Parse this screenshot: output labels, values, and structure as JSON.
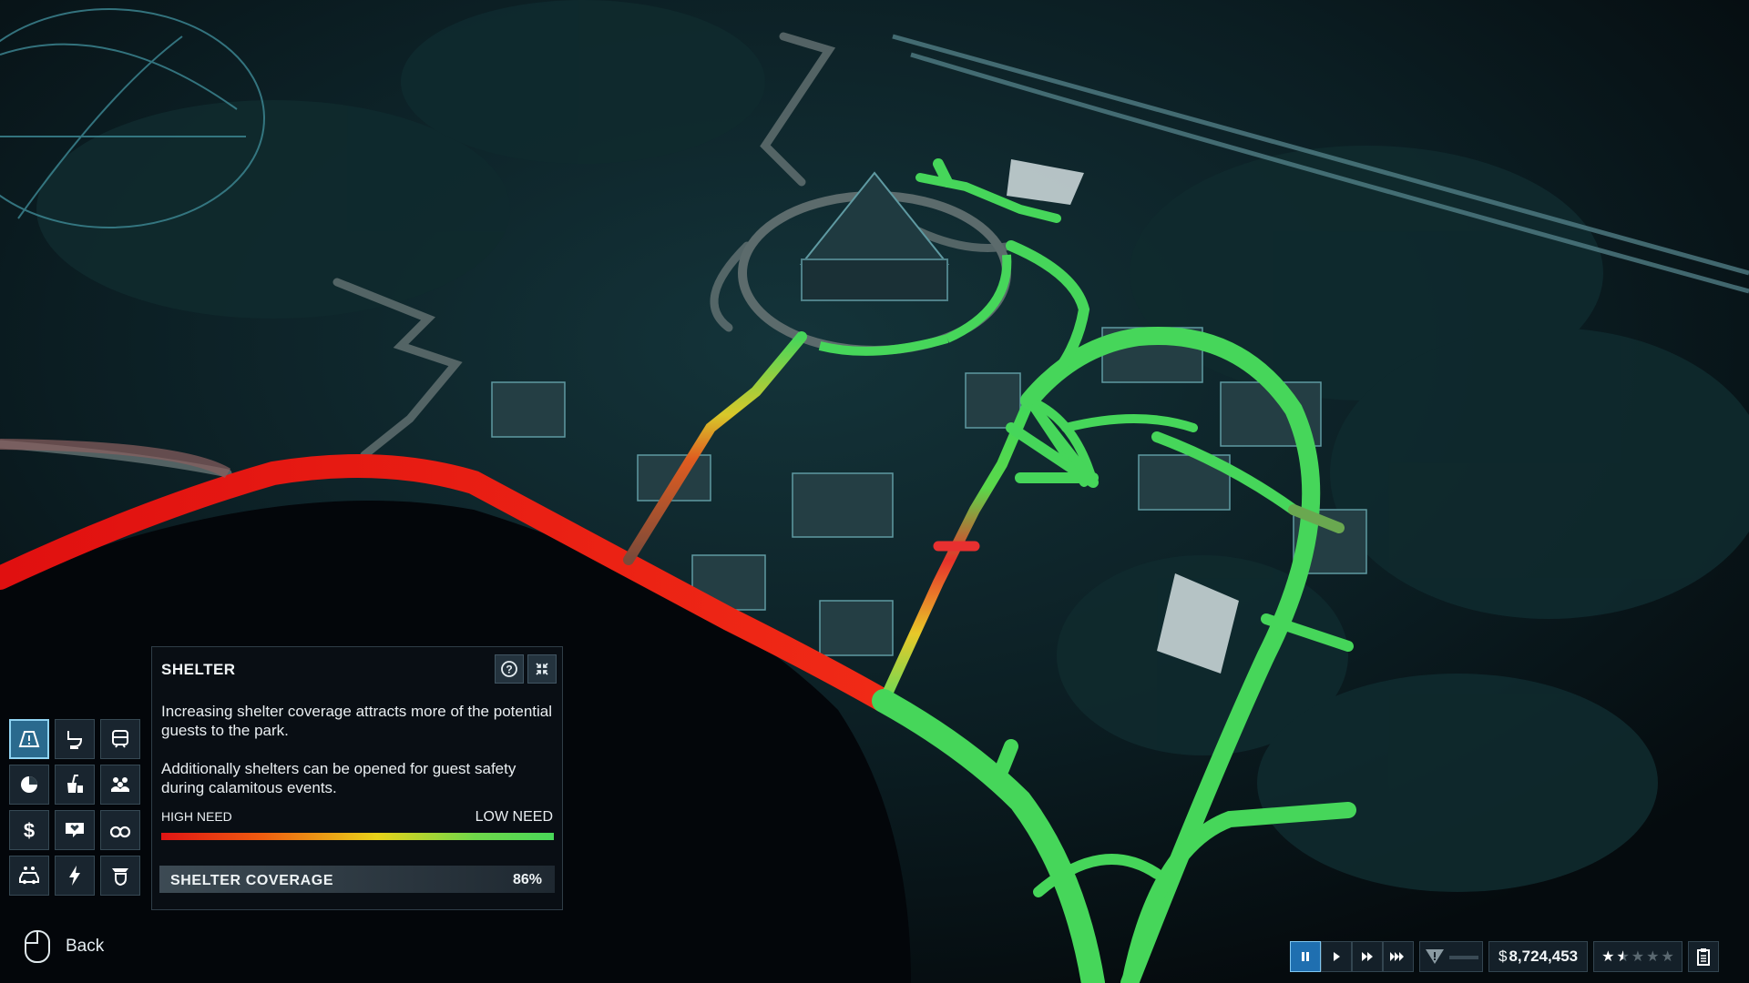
{
  "panel": {
    "title": "SHELTER",
    "description_1": "Increasing shelter coverage attracts more of the potential guests to the park.",
    "description_2": "Additionally shelters can be opened for guest safety during calamitous events.",
    "legend_high": "HIGH NEED",
    "legend_low": "LOW NEED",
    "coverage_label": "SHELTER COVERAGE",
    "coverage_value": "86%",
    "coverage_fraction": 0.86,
    "help_icon": "question-icon",
    "close_icon": "collapse-icon"
  },
  "toolbar": {
    "tools": [
      {
        "icon": "shelter-icon",
        "active": true
      },
      {
        "icon": "toilet-icon",
        "active": false
      },
      {
        "icon": "transport-icon",
        "active": false
      },
      {
        "icon": "guest-appeal-icon",
        "active": false
      },
      {
        "icon": "food-drink-icon",
        "active": false
      },
      {
        "icon": "crowd-icon",
        "active": false
      },
      {
        "icon": "money-icon",
        "active": false
      },
      {
        "icon": "shop-icon",
        "active": false
      },
      {
        "icon": "viewing-icon",
        "active": false
      },
      {
        "icon": "vehicle-icon",
        "active": false
      },
      {
        "icon": "power-icon",
        "active": false
      },
      {
        "icon": "security-icon",
        "active": false
      }
    ]
  },
  "back": {
    "label": "Back",
    "icon": "mouse-icon"
  },
  "status_bar": {
    "speed_buttons": [
      "pause-icon",
      "play-icon",
      "fast-forward-icon",
      "fastest-icon"
    ],
    "active_speed": "pause-icon",
    "threat_icon": "warning-icon",
    "currency": "$",
    "money": "8,724,453",
    "rating_stars": 1.5,
    "clipboard_icon": "clipboard-icon"
  },
  "colors": {
    "high_need": "#e01414",
    "mid_need": "#e8d21a",
    "low_need": "#48d858",
    "accent": "#2a6a8e"
  }
}
